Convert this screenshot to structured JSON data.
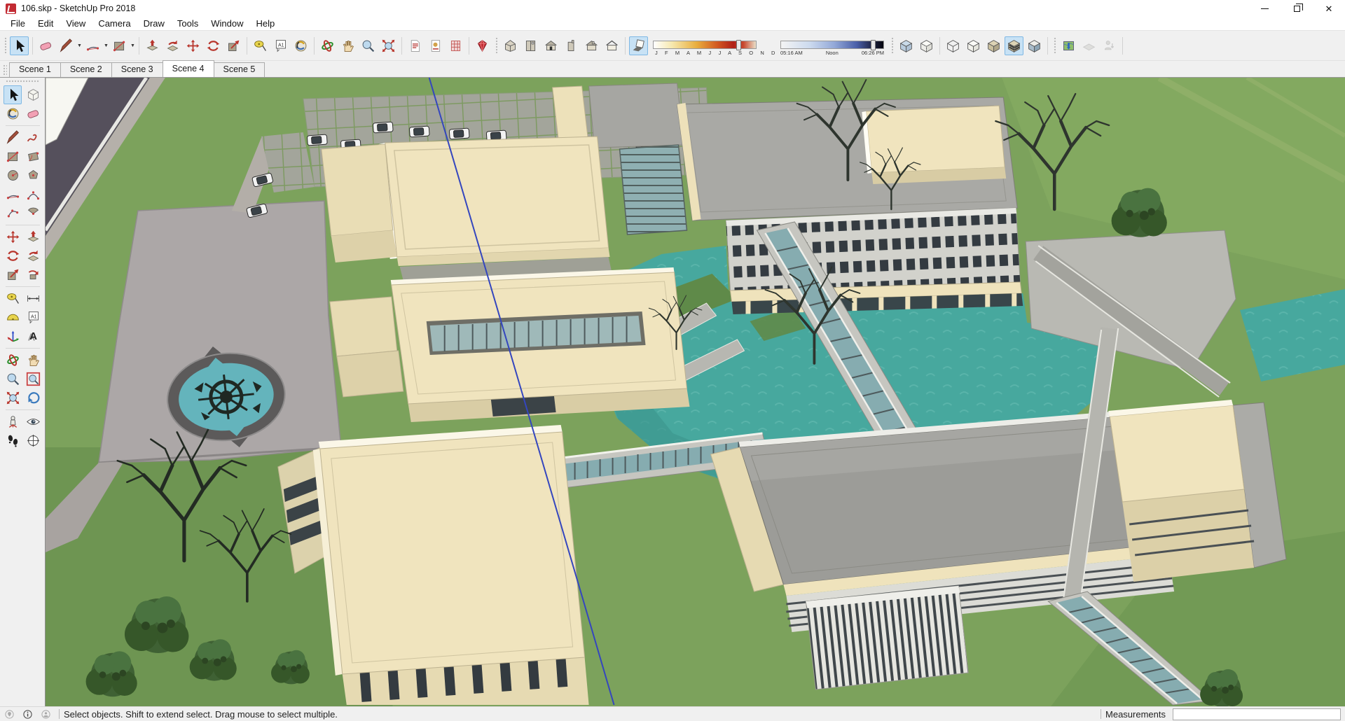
{
  "window": {
    "title": "106.skp - SketchUp Pro 2018"
  },
  "menu": {
    "items": [
      "File",
      "Edit",
      "View",
      "Camera",
      "Draw",
      "Tools",
      "Window",
      "Help"
    ]
  },
  "toolbar": {
    "left_items": [
      "grip",
      "select",
      "|",
      "eraser",
      "line",
      "caret",
      "arc",
      "caret",
      "rect",
      "caret",
      "|",
      "pushpull",
      "followme",
      "move",
      "rotate",
      "scale",
      "|",
      "tape",
      "text",
      "paint",
      "|",
      "orbit",
      "pan",
      "zoom",
      "zoomext",
      "|",
      "page1",
      "page2",
      "page3",
      "|",
      "gem",
      "grip",
      "houseiso",
      "housetop",
      "housefront",
      "houseright",
      "houseback",
      "houseleft",
      "|",
      "shadowbox"
    ],
    "right_items": [
      "grip",
      "xray",
      "backedges",
      "|",
      "wireframe",
      "hiddenline",
      "shaded",
      "textured",
      "mono",
      "|",
      "grip",
      "geomap",
      "terrain",
      "addperson",
      "|"
    ],
    "active_tools": [
      "select",
      "textured",
      "shadowbox"
    ],
    "disabled_tools": [
      "terrain",
      "addperson"
    ]
  },
  "shadows": {
    "months_labels": "J F M A M J J A S O N D",
    "time_start": "05:16 AM",
    "time_noon": "Noon",
    "time_end": "06:26 PM",
    "date_handle_pct": 81,
    "time_handle_pct": 88
  },
  "scene_tabs": {
    "tabs": [
      "Scene 1",
      "Scene 2",
      "Scene 3",
      "Scene 4",
      "Scene 5"
    ],
    "active": "Scene 4"
  },
  "palette": {
    "items": [
      "select",
      "makecomp",
      "paint",
      "eraser",
      "|",
      "line",
      "freehand",
      "rect",
      "rrect",
      "circle",
      "polygon",
      "arc",
      "arc2",
      "arc3",
      "pie",
      "|",
      "move",
      "pushpull",
      "rotate",
      "followme",
      "scale",
      "offset",
      "|",
      "tape",
      "dimension",
      "protractor",
      "text",
      "axes",
      "text3d",
      "|",
      "orbit",
      "pan",
      "zoom",
      "zoomwin",
      "zoomext",
      "previous",
      "|",
      "poscam",
      "look",
      "walk",
      "section"
    ],
    "active_tools": [
      "select"
    ]
  },
  "statusbar": {
    "hint": "Select objects. Shift to extend select. Drag mouse to select multiple.",
    "measurements_label": "Measurements",
    "measurements_value": ""
  },
  "colors": {
    "grass": "#7CA25C",
    "water": "#47A89E",
    "plaza": "#ACA7A7",
    "road": "#55505C",
    "building_cream": "#F0E4BE",
    "building_shade": "#D9CDA5",
    "roof_gray": "#9C9C98",
    "glass": "#86ACB0",
    "axis_blue": "#3446BE",
    "tool_highlight": "#C8E2F5",
    "app_red": "#C22B33"
  }
}
